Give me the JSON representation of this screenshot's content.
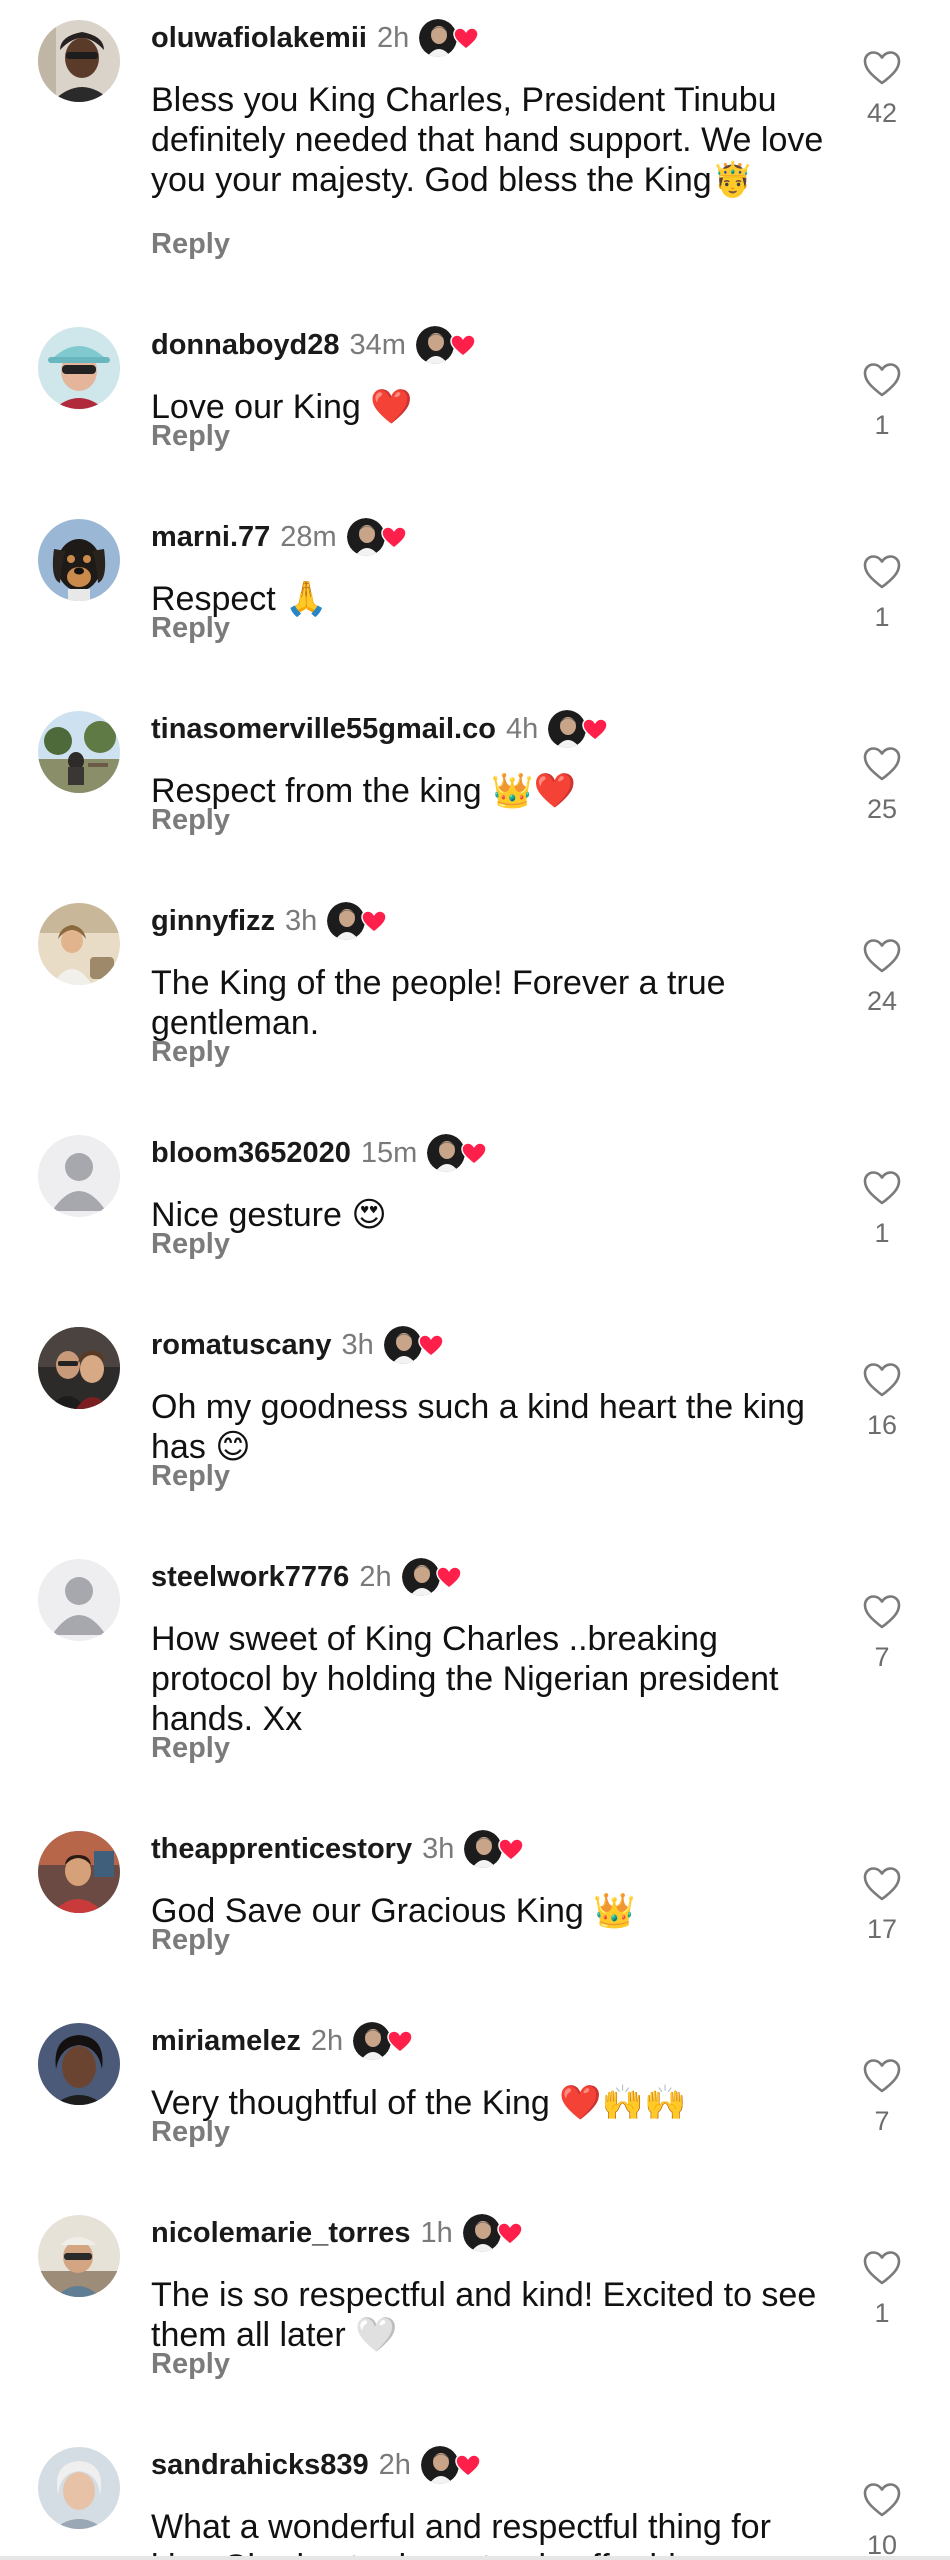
{
  "colors": {
    "background": "#ffffff",
    "text": "#111111",
    "muted": "#7b7b7b",
    "creator_heart": "#ff1f4b"
  },
  "icons": {
    "like": "heart-outline-icon",
    "creator_liked": "creator-heart-icon"
  },
  "comments": [
    {
      "username": "oluwafiolakemii",
      "time": "2h",
      "text": "Bless you King Charles, President Tinubu definitely needed that hand support. We love you your majesty. God bless the King🤴",
      "reply_label": "Reply",
      "likes": "42",
      "creator_liked": true
    },
    {
      "username": "donnaboyd28",
      "time": "34m",
      "text": "Love our King ❤️",
      "reply_label": "Reply",
      "likes": "1",
      "creator_liked": true
    },
    {
      "username": "marni.77",
      "time": "28m",
      "text": "Respect 🙏",
      "reply_label": "Reply",
      "likes": "1",
      "creator_liked": true
    },
    {
      "username": "tinasomerville55gmail.co",
      "time": "4h",
      "text": "Respect from the king 👑❤️",
      "reply_label": "Reply",
      "likes": "25",
      "creator_liked": true
    },
    {
      "username": "ginnyfizz",
      "time": "3h",
      "text": "The King of the people! Forever a true gentleman.",
      "reply_label": "Reply",
      "likes": "24",
      "creator_liked": true
    },
    {
      "username": "bloom3652020",
      "time": "15m",
      "text": "Nice gesture 😍",
      "reply_label": "Reply",
      "likes": "1",
      "creator_liked": true
    },
    {
      "username": "romatuscany",
      "time": "3h",
      "text": "Oh my goodness such a kind heart the king has 😊",
      "reply_label": "Reply",
      "likes": "16",
      "creator_liked": true
    },
    {
      "username": "steelwork7776",
      "time": "2h",
      "text": "How sweet of King Charles ..breaking protocol by holding the Nigerian president hands.  Xx",
      "reply_label": "Reply",
      "likes": "7",
      "creator_liked": true
    },
    {
      "username": "theapprenticestory",
      "time": "3h",
      "text": "God Save our Gracious King 👑",
      "reply_label": "Reply",
      "likes": "17",
      "creator_liked": true
    },
    {
      "username": "miriamelez",
      "time": "2h",
      "text": "Very thoughtful of the King ❤️🙌🙌",
      "reply_label": "Reply",
      "likes": "7",
      "creator_liked": true
    },
    {
      "username": "nicolemarie_torres",
      "time": "1h",
      "text": "The is so respectful and kind! Excited to see them all later 🤍",
      "reply_label": "Reply",
      "likes": "1",
      "creator_liked": true
    },
    {
      "username": "sandrahicks839",
      "time": "2h",
      "text": "What a wonderful and respectful thing for king Charles to do, not only offer his",
      "reply_label": "Reply",
      "likes": "10",
      "creator_liked": true
    }
  ]
}
